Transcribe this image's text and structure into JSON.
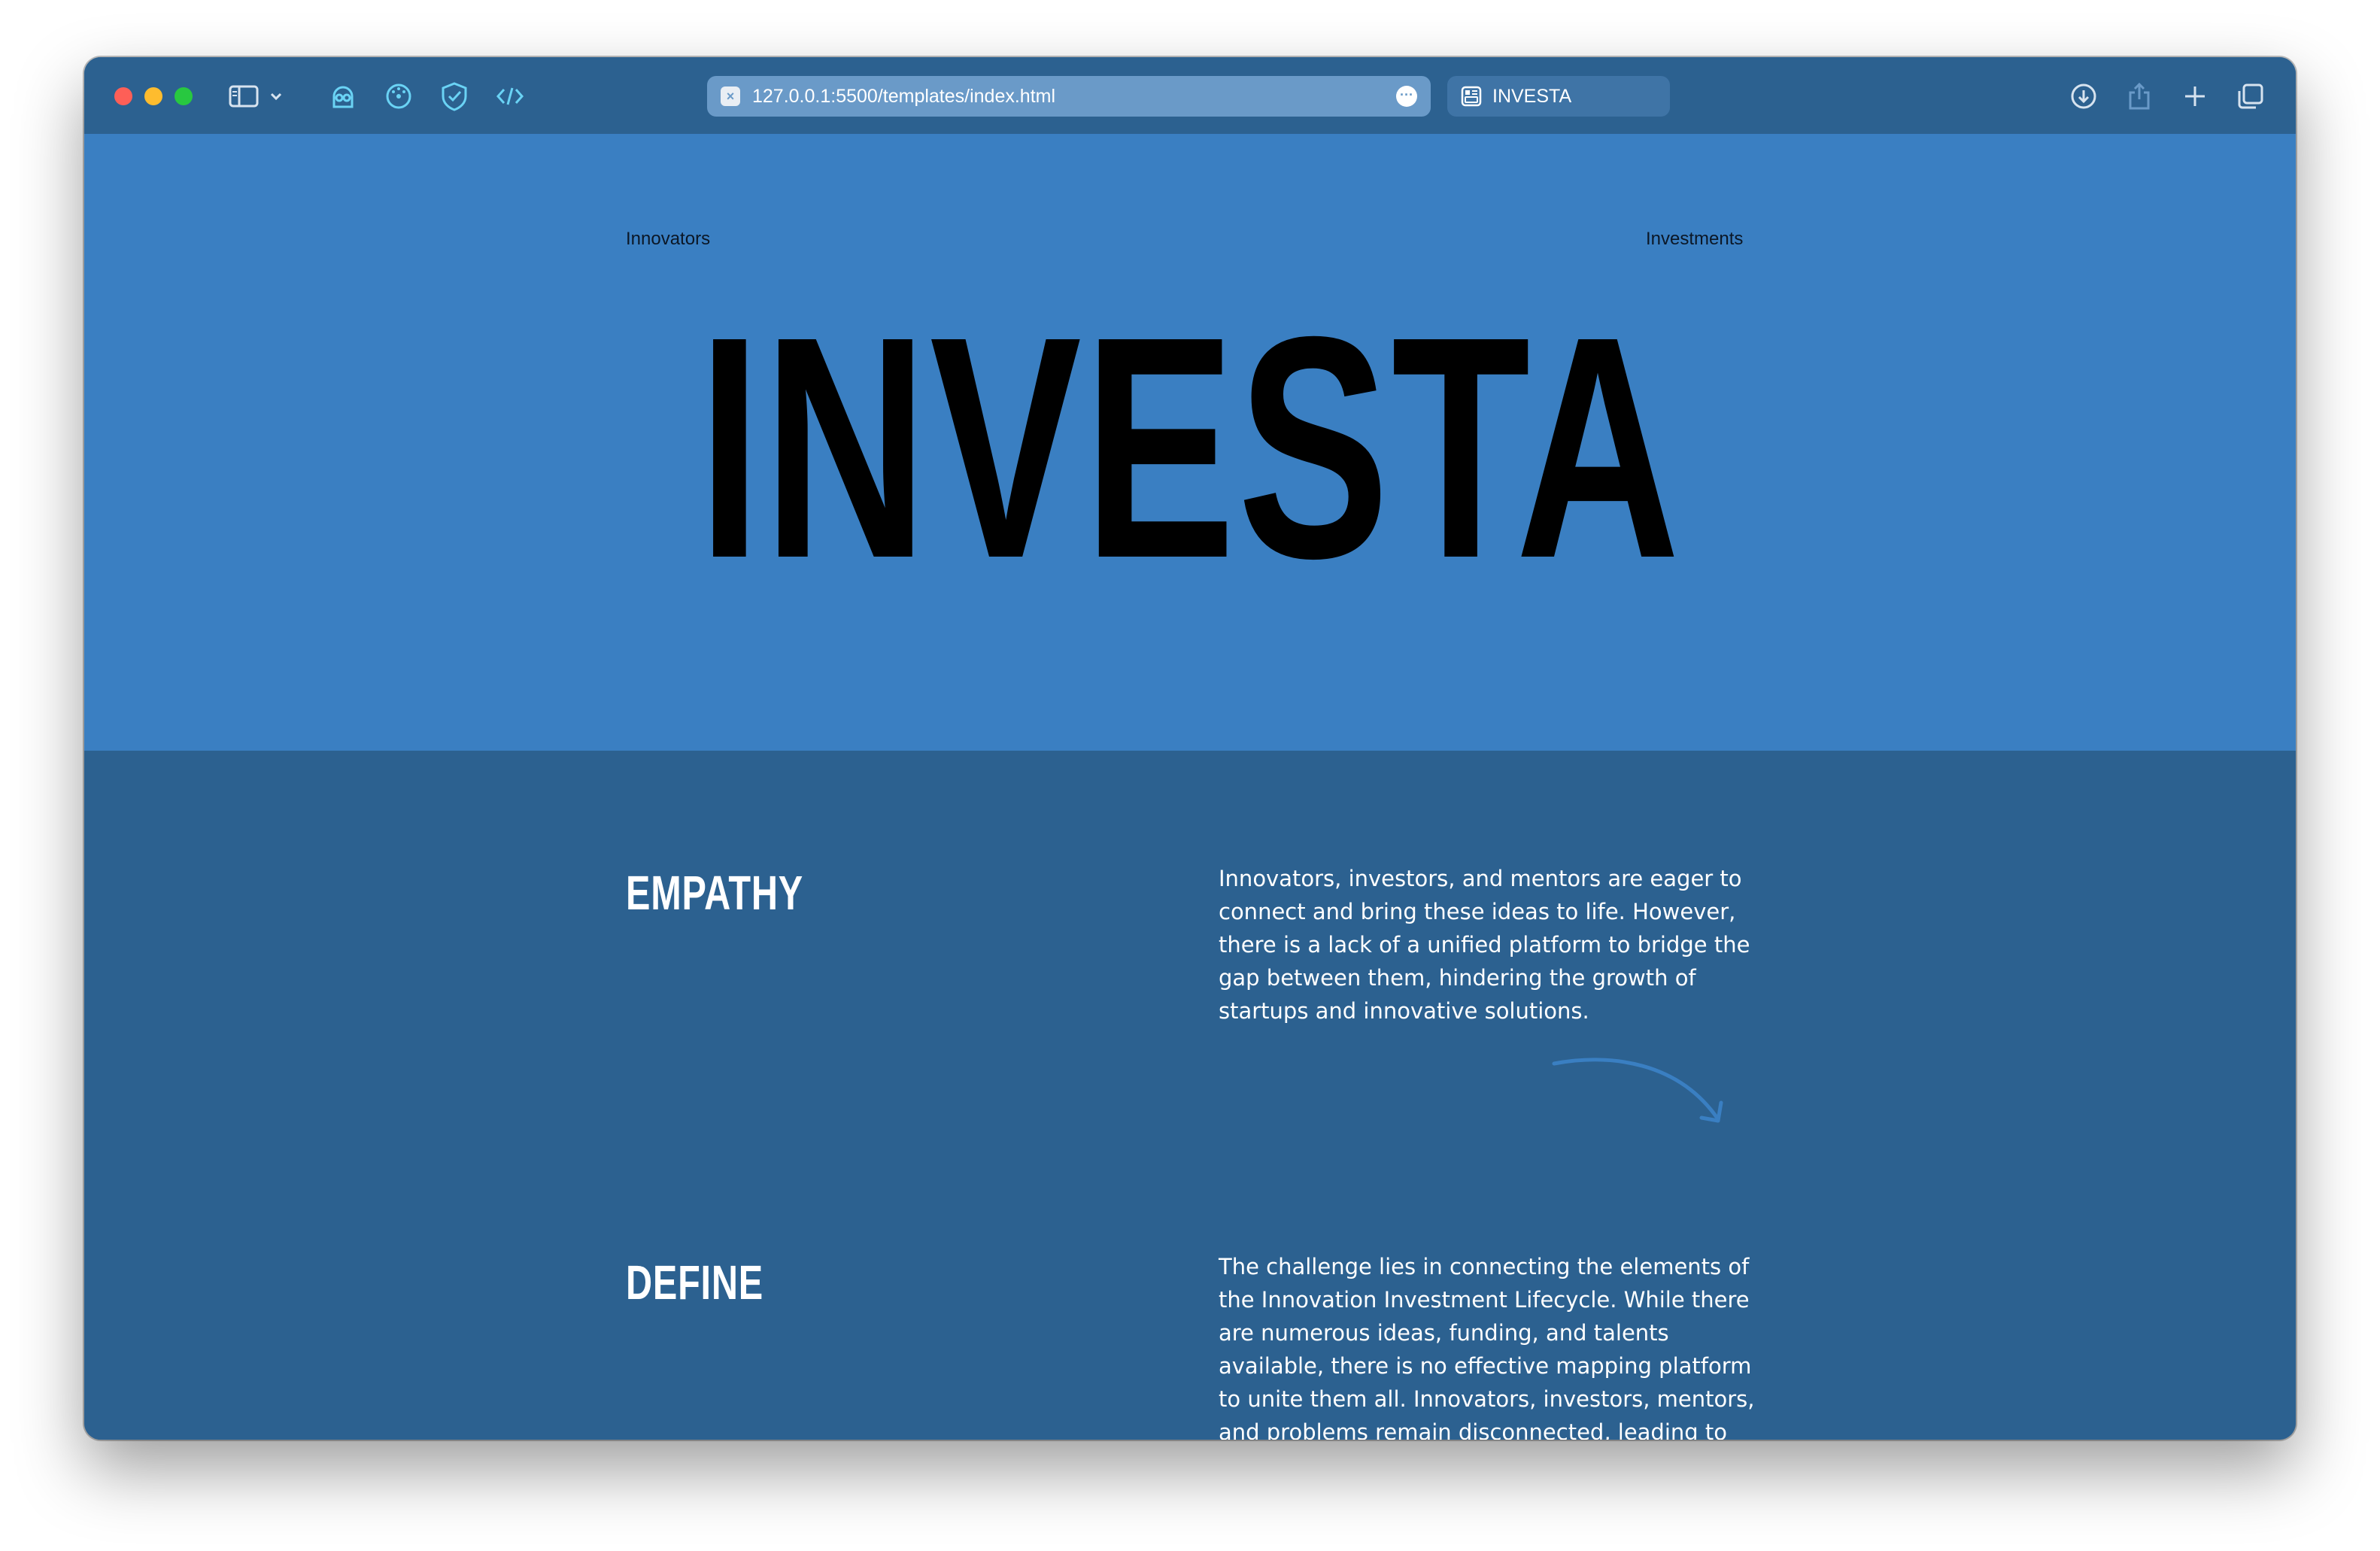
{
  "browser": {
    "url": "127.0.0.1:5500/templates/index.html",
    "tab_title": "INVESTA",
    "toolbar_icons": [
      "sidebar-icon",
      "chevron-down-icon",
      "extension-ghost-icon",
      "extension-dial-icon",
      "shield-check-icon",
      "code-brackets-icon",
      "download-icon",
      "share-icon",
      "plus-icon",
      "tabs-overview-icon"
    ]
  },
  "hero": {
    "nav_left": "Innovators",
    "nav_right": "Investments",
    "logo": "INVESTA",
    "background": "#3a7fc2"
  },
  "sections": [
    {
      "title": "EMPATHY",
      "text": "Innovators, investors, and mentors are eager to connect and bring these ideas to life. However, there is a lack of a unified platform to bridge the gap between them, hindering the growth of startups and innovative solutions."
    },
    {
      "title": "DEFINE",
      "text": "The challenge lies in connecting the elements of the Innovation Investment Lifecycle. While there are numerous ideas, funding, and talents available, there is no effective mapping platform to unite them all. Innovators, investors, mentors, and problems remain disconnected, leading to"
    }
  ],
  "colors": {
    "content_background": "#2c6190",
    "accent_arrow": "#3a7fc2"
  }
}
